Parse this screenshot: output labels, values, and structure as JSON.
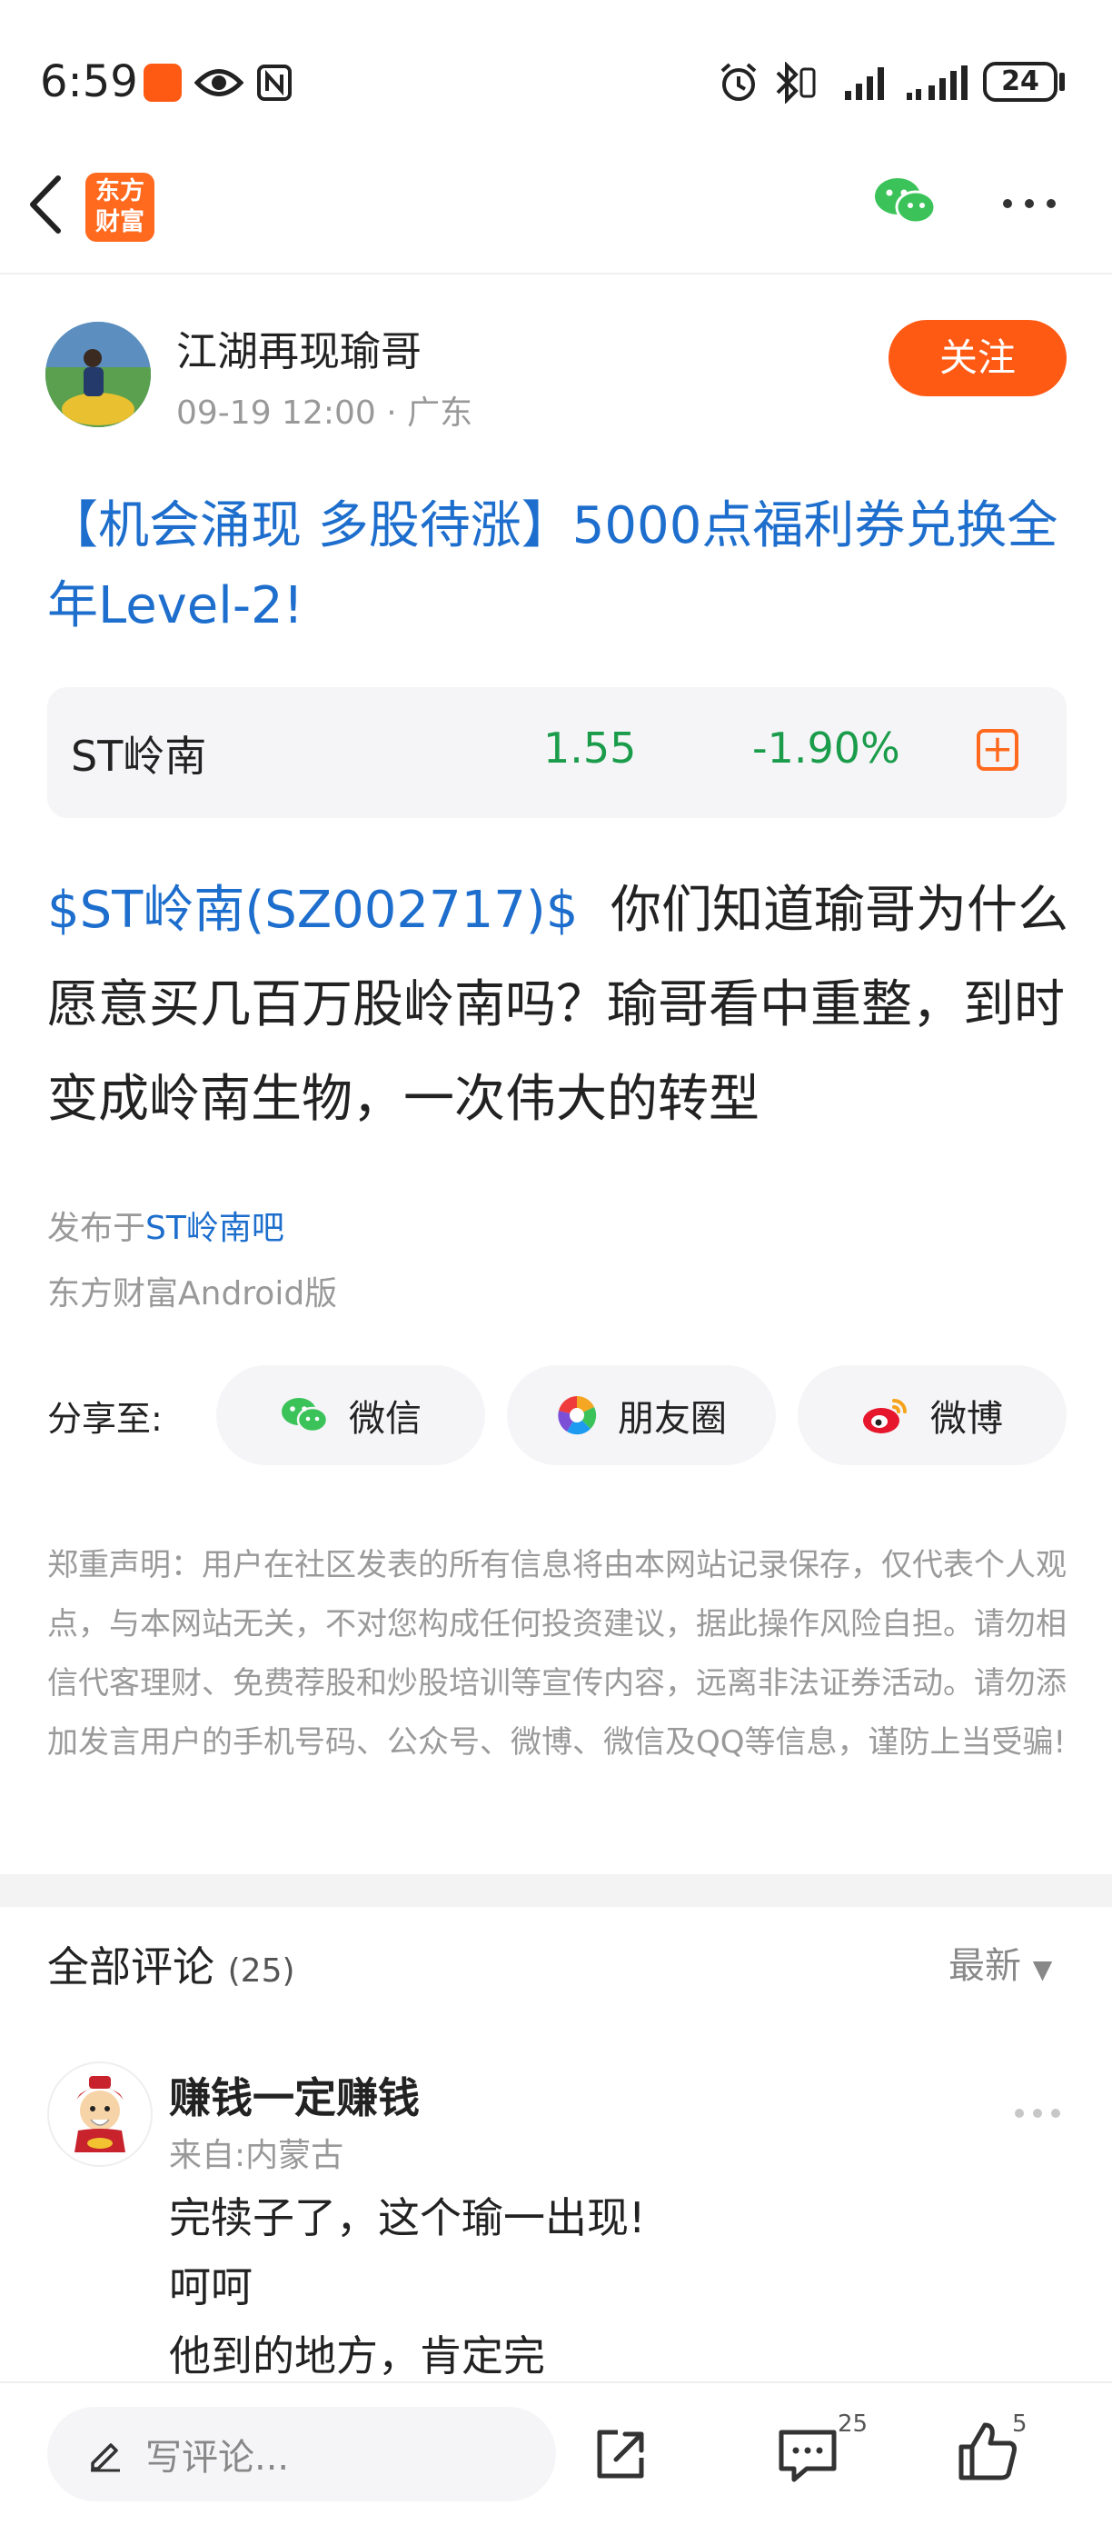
{
  "status_bar": {
    "time": "6:59",
    "battery": "24"
  },
  "nav": {
    "logo_text_line1": "东方",
    "logo_text_line2": "财富"
  },
  "author": {
    "name": "江湖再现瑜哥",
    "meta": "09-19 12:00 · 广东",
    "follow_label": "关注"
  },
  "headline": "【机会涌现 多股待涨】5000点福利券兑换全年Level-2!",
  "stock": {
    "name": "ST岭南",
    "price": "1.55",
    "change": "-1.90%"
  },
  "post": {
    "tag": "$ST岭南(SZ002717)$",
    "text": "你们知道瑜哥为什么愿意买几百万股岭南吗？瑜哥看中重整，到时变成岭南生物，一次伟大的转型"
  },
  "publish": {
    "prefix": "发布于",
    "forum": "ST岭南吧",
    "source": "东方财富Android版"
  },
  "share": {
    "label": "分享至:",
    "wechat": "微信",
    "moments": "朋友圈",
    "weibo": "微博"
  },
  "disclaimer": "郑重声明：用户在社区发表的所有信息将由本网站记录保存，仅代表个人观点，与本网站无关，不对您构成任何投资建议，据此操作风险自担。请勿相信代客理财、免费荐股和炒股培训等宣传内容，远离非法证券活动。请勿添加发言用户的手机号码、公众号、微博、微信及QQ等信息，谨防上当受骗!",
  "comments": {
    "title": "全部评论",
    "count": "(25)",
    "sort": "最新",
    "items": [
      {
        "name": "赚钱一定赚钱",
        "from": "来自:内蒙古",
        "text": "完犊子了，这个瑜一出现!\n呵呵\n他到的地方，肯定完"
      }
    ]
  },
  "bottom_bar": {
    "placeholder": "写评论...",
    "comment_count": "25",
    "like_count": "5"
  },
  "colors": {
    "accent": "#ff5a14",
    "link": "#1d6ecd",
    "down": "#1a9c4a"
  }
}
